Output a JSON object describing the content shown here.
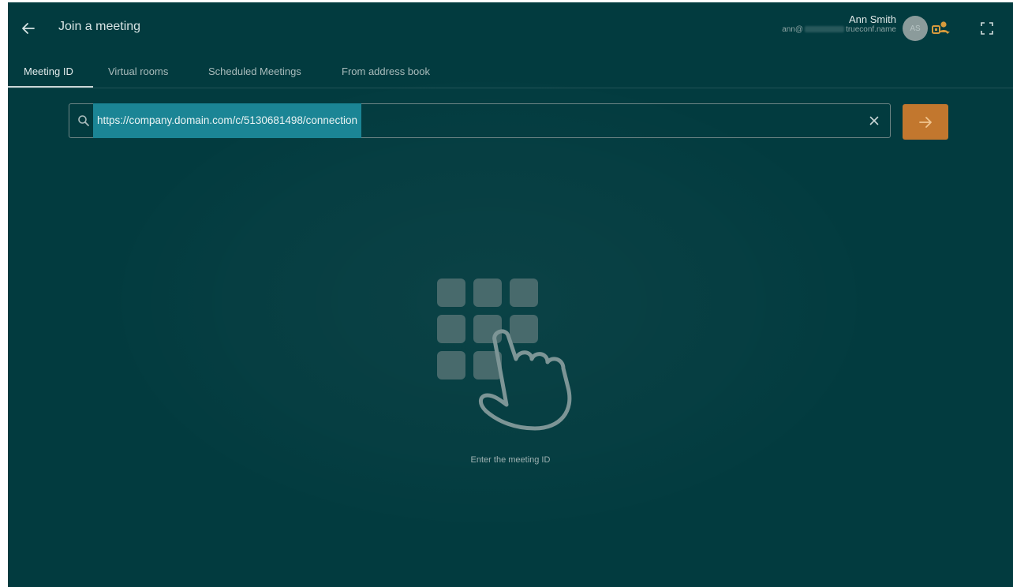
{
  "header": {
    "title": "Join a meeting",
    "user_name": "Ann Smith",
    "user_email_prefix": "ann@",
    "user_email_suffix": "trueconf.name",
    "avatar_initials": "AS"
  },
  "tabs": [
    {
      "label": "Meeting ID",
      "active": true
    },
    {
      "label": "Virtual rooms",
      "active": false
    },
    {
      "label": "Scheduled Meetings",
      "active": false
    },
    {
      "label": "From address book",
      "active": false
    }
  ],
  "search": {
    "value": "https://company.domain.com/c/5130681498/connection"
  },
  "main": {
    "hint": "Enter the meeting ID"
  },
  "icons": {
    "back": "arrow-left-icon",
    "contacts": "contacts-icon",
    "fullscreen": "fullscreen-icon",
    "search": "search-icon",
    "clear": "close-icon",
    "go": "arrow-right-icon",
    "illustration": "keypad-hand-icon"
  },
  "colors": {
    "background": "#023b3f",
    "accent": "#c2772e",
    "selection": "#1b8595"
  }
}
